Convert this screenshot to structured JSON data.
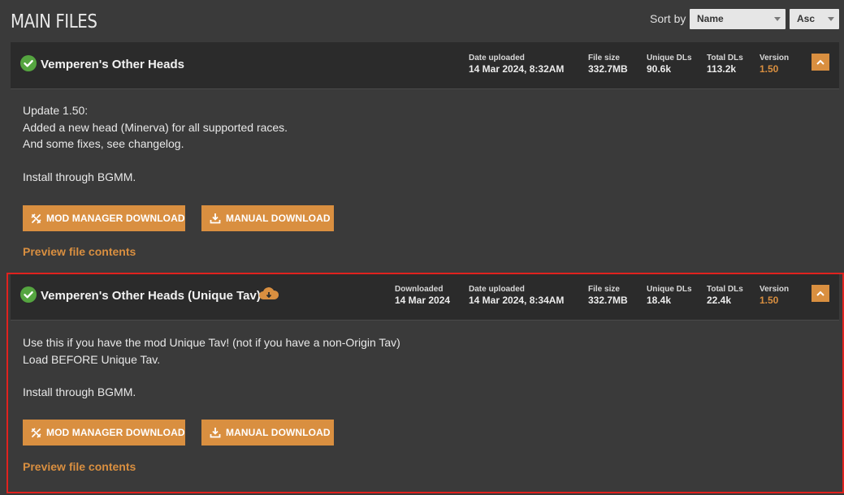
{
  "header": {
    "title": "MAIN FILES",
    "sort_label": "Sort by",
    "sort_field": "Name",
    "sort_order": "Asc"
  },
  "files": [
    {
      "title": "Vemperen's Other Heads",
      "meta": {
        "date_label": "Date uploaded",
        "date": "14 Mar 2024, 8:32AM",
        "size_label": "File size",
        "size": "332.7MB",
        "unique_label": "Unique DLs",
        "unique": "90.6k",
        "total_label": "Total DLs",
        "total": "113.2k",
        "version_label": "Version",
        "version": "1.50"
      },
      "description": [
        "Update 1.50:",
        "Added a new head (Minerva) for all supported races.",
        "And some fixes, see changelog.",
        "",
        "Install through BGMM."
      ],
      "mod_manager_label": "MOD MANAGER DOWNLOAD",
      "manual_label": "MANUAL DOWNLOAD",
      "preview_label": "Preview file contents"
    },
    {
      "title": "Vemperen's Other Heads (Unique Tav)",
      "meta": {
        "downloaded_label": "Downloaded",
        "downloaded": "14 Mar 2024",
        "date_label": "Date uploaded",
        "date": "14 Mar 2024, 8:34AM",
        "size_label": "File size",
        "size": "332.7MB",
        "unique_label": "Unique DLs",
        "unique": "18.4k",
        "total_label": "Total DLs",
        "total": "22.4k",
        "version_label": "Version",
        "version": "1.50"
      },
      "description": [
        "Use this if you have the mod Unique Tav! (not if you have a non-Origin Tav)",
        "Load BEFORE Unique Tav.",
        "",
        "Install through BGMM."
      ],
      "mod_manager_label": "MOD MANAGER DOWNLOAD",
      "manual_label": "MANUAL DOWNLOAD",
      "preview_label": "Preview file contents"
    }
  ],
  "colors": {
    "accent": "#d98f40",
    "success": "#55a540",
    "highlight": "#e0221e"
  },
  "icons": [
    "check-circle-icon",
    "cloud-download-icon",
    "chevron-up-icon",
    "mod-manager-icon",
    "download-icon"
  ]
}
